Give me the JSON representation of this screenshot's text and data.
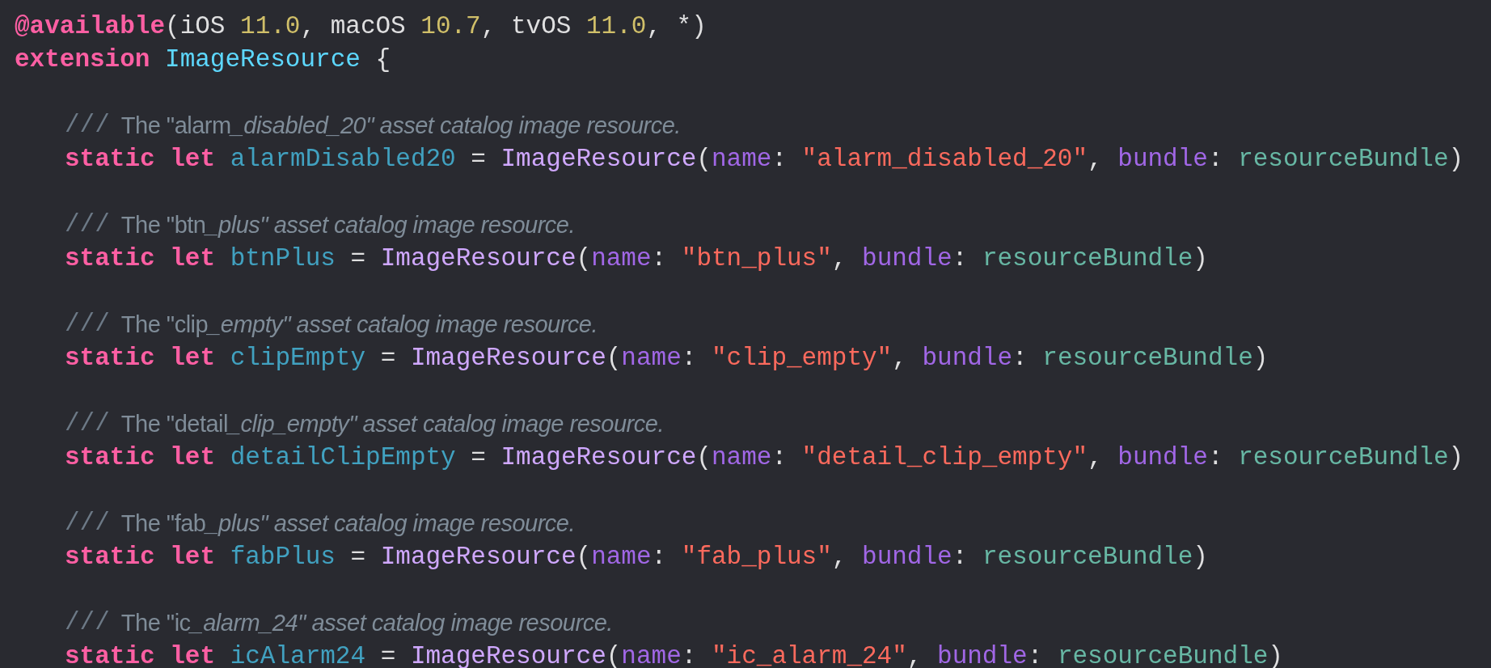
{
  "header": [
    {
      "tokens": [
        {
          "kind": "attribute",
          "text": "@available"
        },
        {
          "kind": "plain",
          "text": "(iOS "
        },
        {
          "kind": "number",
          "text": "11.0"
        },
        {
          "kind": "plain",
          "text": ", macOS "
        },
        {
          "kind": "number",
          "text": "10.7"
        },
        {
          "kind": "plain",
          "text": ", tvOS "
        },
        {
          "kind": "number",
          "text": "11.0"
        },
        {
          "kind": "plain",
          "text": ", *)"
        }
      ]
    },
    {
      "tokens": [
        {
          "kind": "keyword",
          "text": "extension "
        },
        {
          "kind": "typedecl",
          "text": "ImageResource"
        },
        {
          "kind": "plain",
          "text": " {"
        }
      ]
    }
  ],
  "members": [
    {
      "comment_marker": "///",
      "comment_lead": "The \"alarm",
      "comment_italic": "_disabled_20\" asset catalog image resource.",
      "tokens": [
        {
          "kind": "keyword",
          "text": "static let "
        },
        {
          "kind": "property",
          "text": "alarmDisabled20"
        },
        {
          "kind": "plain",
          "text": " = "
        },
        {
          "kind": "type",
          "text": "ImageResource"
        },
        {
          "kind": "plain",
          "text": "("
        },
        {
          "kind": "param",
          "text": "name"
        },
        {
          "kind": "plain",
          "text": ": "
        },
        {
          "kind": "string",
          "text": "\"alarm_disabled_20\""
        },
        {
          "kind": "plain",
          "text": ", "
        },
        {
          "kind": "param",
          "text": "bundle"
        },
        {
          "kind": "plain",
          "text": ": "
        },
        {
          "kind": "member",
          "text": "resourceBundle"
        },
        {
          "kind": "plain",
          "text": ")"
        }
      ]
    },
    {
      "comment_marker": "///",
      "comment_lead": "The \"btn",
      "comment_italic": "_plus\" asset catalog image resource.",
      "tokens": [
        {
          "kind": "keyword",
          "text": "static let "
        },
        {
          "kind": "property",
          "text": "btnPlus"
        },
        {
          "kind": "plain",
          "text": " = "
        },
        {
          "kind": "type",
          "text": "ImageResource"
        },
        {
          "kind": "plain",
          "text": "("
        },
        {
          "kind": "param",
          "text": "name"
        },
        {
          "kind": "plain",
          "text": ": "
        },
        {
          "kind": "string",
          "text": "\"btn_plus\""
        },
        {
          "kind": "plain",
          "text": ", "
        },
        {
          "kind": "param",
          "text": "bundle"
        },
        {
          "kind": "plain",
          "text": ": "
        },
        {
          "kind": "member",
          "text": "resourceBundle"
        },
        {
          "kind": "plain",
          "text": ")"
        }
      ]
    },
    {
      "comment_marker": "///",
      "comment_lead": "The \"clip",
      "comment_italic": "_empty\" asset catalog image resource.",
      "tokens": [
        {
          "kind": "keyword",
          "text": "static let "
        },
        {
          "kind": "property",
          "text": "clipEmpty"
        },
        {
          "kind": "plain",
          "text": " = "
        },
        {
          "kind": "type",
          "text": "ImageResource"
        },
        {
          "kind": "plain",
          "text": "("
        },
        {
          "kind": "param",
          "text": "name"
        },
        {
          "kind": "plain",
          "text": ": "
        },
        {
          "kind": "string",
          "text": "\"clip_empty\""
        },
        {
          "kind": "plain",
          "text": ", "
        },
        {
          "kind": "param",
          "text": "bundle"
        },
        {
          "kind": "plain",
          "text": ": "
        },
        {
          "kind": "member",
          "text": "resourceBundle"
        },
        {
          "kind": "plain",
          "text": ")"
        }
      ]
    },
    {
      "comment_marker": "///",
      "comment_lead": "The \"detail",
      "comment_italic": "_clip_empty\" asset catalog image resource.",
      "tokens": [
        {
          "kind": "keyword",
          "text": "static let "
        },
        {
          "kind": "property",
          "text": "detailClipEmpty"
        },
        {
          "kind": "plain",
          "text": " = "
        },
        {
          "kind": "type",
          "text": "ImageResource"
        },
        {
          "kind": "plain",
          "text": "("
        },
        {
          "kind": "param",
          "text": "name"
        },
        {
          "kind": "plain",
          "text": ": "
        },
        {
          "kind": "string",
          "text": "\"detail_clip_empty\""
        },
        {
          "kind": "plain",
          "text": ", "
        },
        {
          "kind": "param",
          "text": "bundle"
        },
        {
          "kind": "plain",
          "text": ": "
        },
        {
          "kind": "member",
          "text": "resourceBundle"
        },
        {
          "kind": "plain",
          "text": ")"
        }
      ]
    },
    {
      "comment_marker": "///",
      "comment_lead": "The \"fab",
      "comment_italic": "_plus\" asset catalog image resource.",
      "tokens": [
        {
          "kind": "keyword",
          "text": "static let "
        },
        {
          "kind": "property",
          "text": "fabPlus"
        },
        {
          "kind": "plain",
          "text": " = "
        },
        {
          "kind": "type",
          "text": "ImageResource"
        },
        {
          "kind": "plain",
          "text": "("
        },
        {
          "kind": "param",
          "text": "name"
        },
        {
          "kind": "plain",
          "text": ": "
        },
        {
          "kind": "string",
          "text": "\"fab_plus\""
        },
        {
          "kind": "plain",
          "text": ", "
        },
        {
          "kind": "param",
          "text": "bundle"
        },
        {
          "kind": "plain",
          "text": ": "
        },
        {
          "kind": "member",
          "text": "resourceBundle"
        },
        {
          "kind": "plain",
          "text": ")"
        }
      ]
    },
    {
      "comment_marker": "///",
      "comment_lead": "The \"ic",
      "comment_italic": "_alarm_24\" asset catalog image resource.",
      "tokens": [
        {
          "kind": "keyword",
          "text": "static let "
        },
        {
          "kind": "property",
          "text": "icAlarm24"
        },
        {
          "kind": "plain",
          "text": " = "
        },
        {
          "kind": "type",
          "text": "ImageResource"
        },
        {
          "kind": "plain",
          "text": "("
        },
        {
          "kind": "param",
          "text": "name"
        },
        {
          "kind": "plain",
          "text": ": "
        },
        {
          "kind": "string",
          "text": "\"ic_alarm_24\""
        },
        {
          "kind": "plain",
          "text": ", "
        },
        {
          "kind": "param",
          "text": "bundle"
        },
        {
          "kind": "plain",
          "text": ": "
        },
        {
          "kind": "member",
          "text": "resourceBundle"
        },
        {
          "kind": "plain",
          "text": ")"
        }
      ]
    }
  ]
}
